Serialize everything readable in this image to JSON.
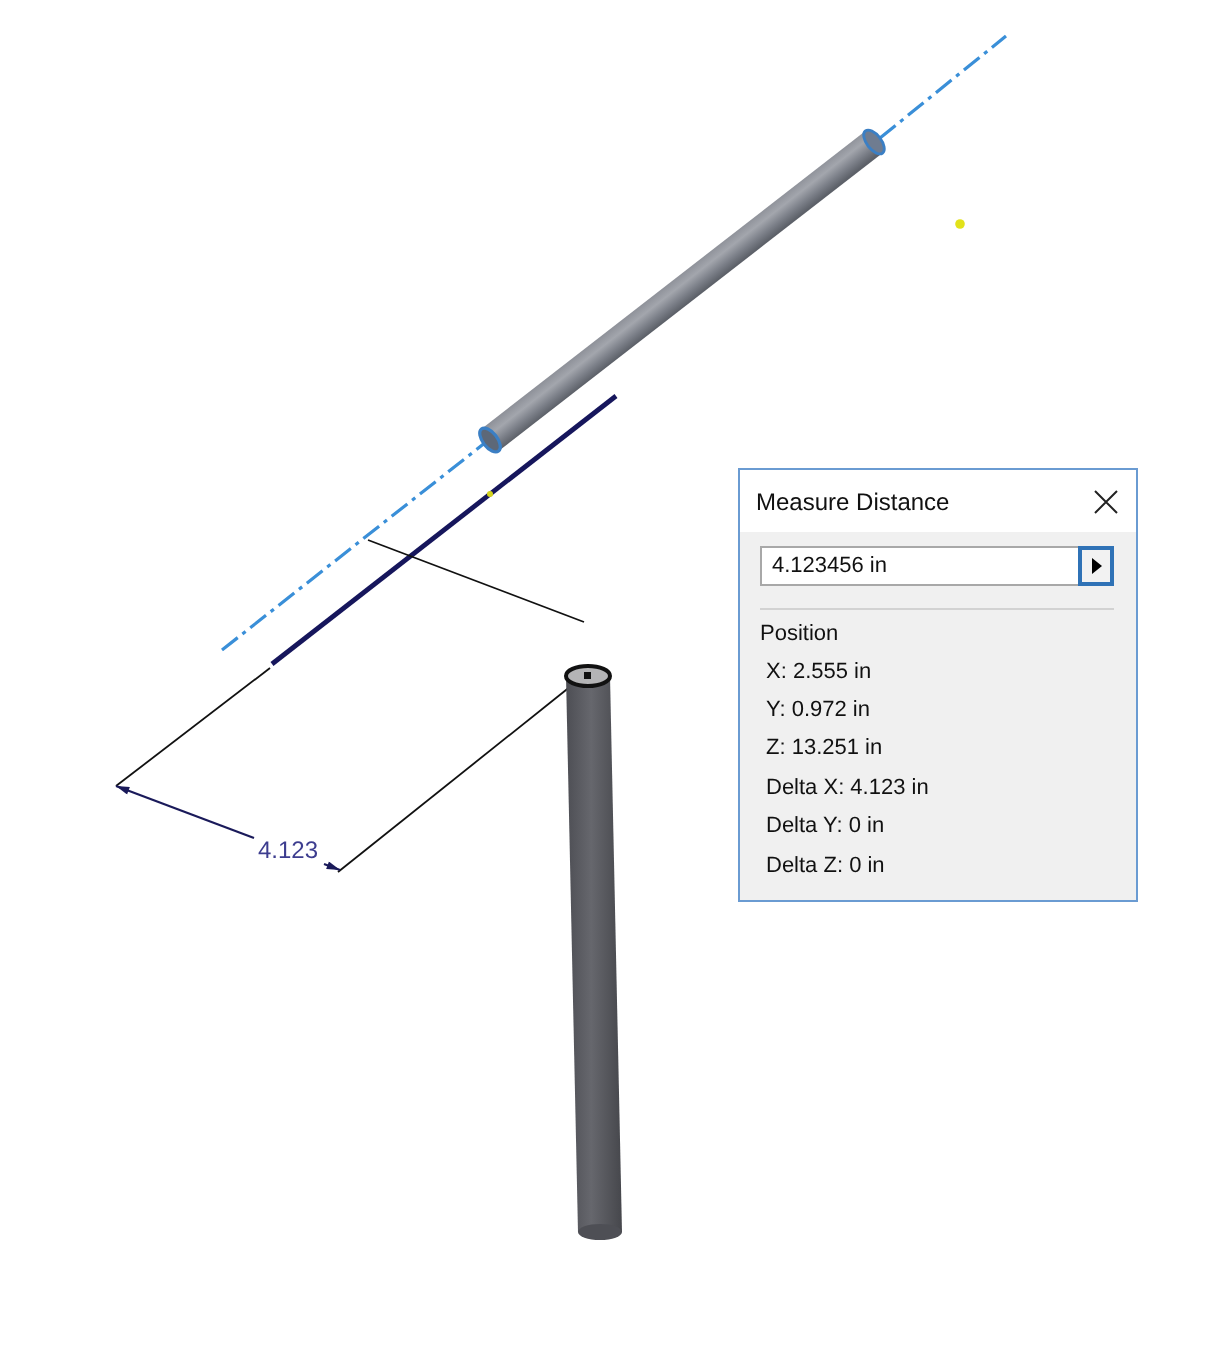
{
  "viewport": {
    "dimension_label": "4.123"
  },
  "dialog": {
    "title": "Measure Distance",
    "distance_field": {
      "value": "4.123456 in"
    },
    "arrow_button": {
      "focused": true
    },
    "section_label": "Position",
    "readouts": [
      "X: 2.555 in",
      "Y: 0.972 in",
      "Z: 13.251 in",
      "Delta X: 4.123 in",
      "Delta Y: 0 in",
      "Delta Z: 0 in"
    ]
  }
}
